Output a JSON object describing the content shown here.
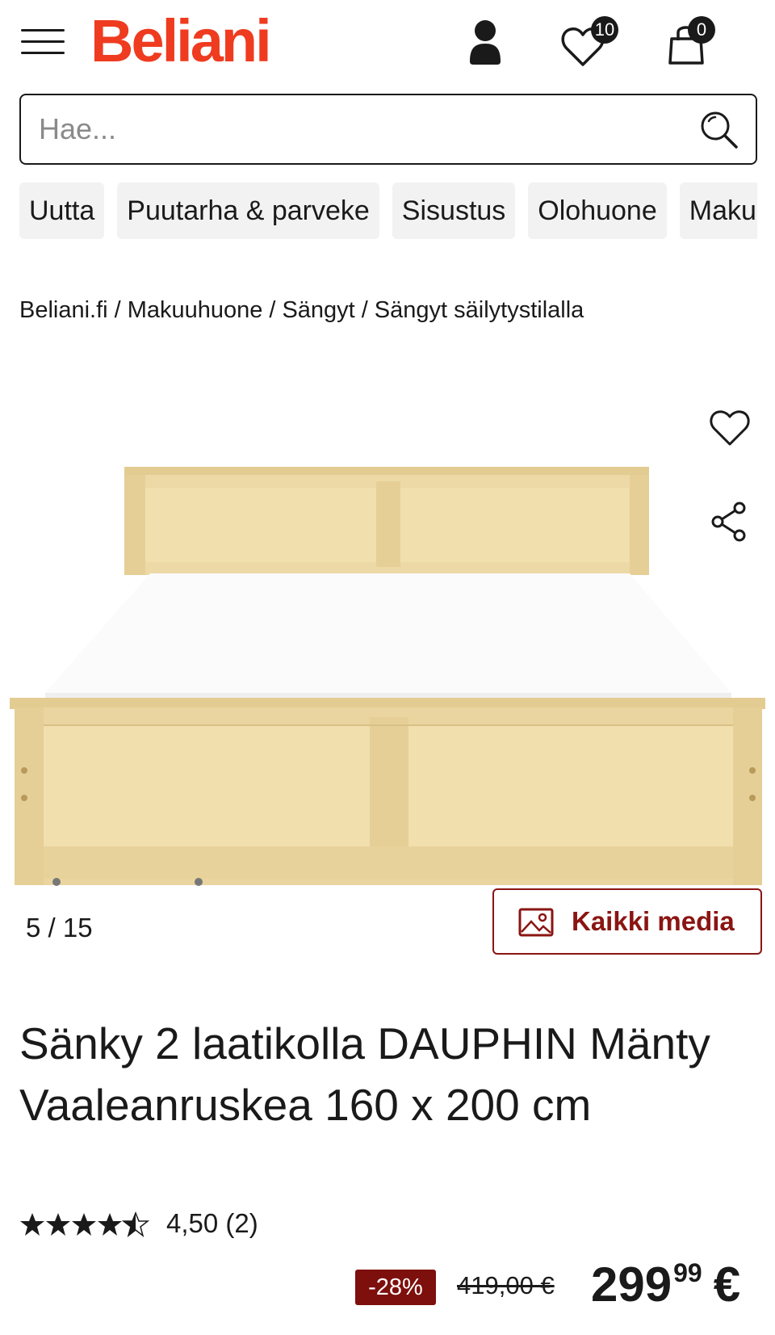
{
  "header": {
    "logo": "Beliani",
    "wishlist_count": "10",
    "cart_count": "0",
    "icons": [
      "menu-icon",
      "user-icon",
      "heart-icon",
      "shopping-bag-icon"
    ]
  },
  "search": {
    "placeholder": "Hae..."
  },
  "categories": [
    "Uutta",
    "Puutarha & parveke",
    "Sisustus",
    "Olohuone",
    "Makuuhuone"
  ],
  "breadcrumb": [
    "Beliani.fi",
    "Makuuhuone",
    "Sängyt",
    "Sängyt säilytystilalla"
  ],
  "gallery": {
    "counter": "5 / 15",
    "all_media_label": "Kaikki media"
  },
  "product": {
    "title": "Sänky 2 laatikolla DAUPHIN Mänty Vaaleanruskea 160 x 200 cm",
    "rating": 4.5,
    "rating_text": "4,50 (2)",
    "discount": "-28%",
    "old_price": "419,00 €",
    "price_main": "299",
    "price_cents": "99",
    "currency": "€"
  },
  "colors": {
    "brand": "#ef3b1f",
    "accent": "#8a1512",
    "discount_bg": "#7d0f0c"
  }
}
